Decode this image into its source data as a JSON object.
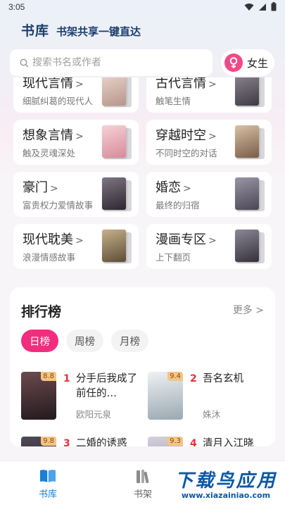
{
  "status_bar": {
    "time": "3:05"
  },
  "header": {
    "title": "书库",
    "slogan": "书架共享一键直达"
  },
  "search": {
    "placeholder": "搜索书名或作者"
  },
  "gender": {
    "label": "女生",
    "accent": "#ef4a86"
  },
  "categories": [
    {
      "name": "现代言情",
      "desc": "细腻纠葛的现代人",
      "cover": "#c9a9a0"
    },
    {
      "name": "古代言情",
      "desc": "触笔生情",
      "cover": "#5f5a63"
    },
    {
      "name": "想象言情",
      "desc": "触及灵魂深处",
      "cover": "#e8aeb8"
    },
    {
      "name": "穿越时空",
      "desc": "不同时空的对话",
      "cover": "#a2826a"
    },
    {
      "name": "豪门",
      "desc": "富贵权力爱情故事",
      "cover": "#4c4650"
    },
    {
      "name": "婚恋",
      "desc": "最终的归宿",
      "cover": "#6e6a77"
    },
    {
      "name": "现代耽美",
      "desc": "浪漫情感故事",
      "cover": "#8d7a5c"
    },
    {
      "name": "漫画专区",
      "desc": "上下翻页",
      "cover": "#54505c"
    }
  ],
  "ranking": {
    "title": "排行榜",
    "more": "更多",
    "tabs": [
      "日榜",
      "周榜",
      "月榜"
    ],
    "active_tab": "日榜",
    "books": [
      {
        "rank": "1",
        "title": "分手后我成了前任的…",
        "author": "欧阳元泉",
        "score": "8.8",
        "cover": "#3a2a30"
      },
      {
        "rank": "2",
        "title": "吾名玄机",
        "author": "姝沐",
        "score": "9.4",
        "cover": "#c9d3d8"
      },
      {
        "rank": "3",
        "title": "二婚的诱惑",
        "author": "",
        "score": "9.8",
        "cover": "#2d2a33"
      },
      {
        "rank": "4",
        "title": "清月入江晓",
        "author": "",
        "score": "9.3",
        "cover": "#b7b3bf"
      }
    ]
  },
  "tab_bar": {
    "items": [
      {
        "label": "书库",
        "active": true
      },
      {
        "label": "书架",
        "active": false
      }
    ],
    "active_color": "#1a7fd6"
  },
  "watermark": {
    "main": "下载鸟应用",
    "url": "www.xiazainiao.com"
  }
}
